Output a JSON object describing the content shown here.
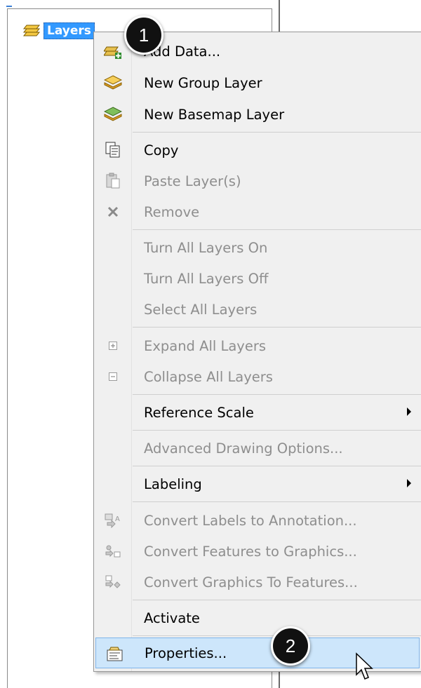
{
  "toc": {
    "root_label": "Layers"
  },
  "menu": {
    "items": [
      {
        "label": "Add Data...",
        "icon": "add-data-icon",
        "enabled": true,
        "submenu": false
      },
      {
        "label": "New Group Layer",
        "icon": "group-layer-icon",
        "enabled": true,
        "submenu": false
      },
      {
        "label": "New Basemap Layer",
        "icon": "basemap-layer-icon",
        "enabled": true,
        "submenu": false
      },
      {
        "label": "Copy",
        "icon": "copy-icon",
        "enabled": true,
        "submenu": false
      },
      {
        "label": "Paste Layer(s)",
        "icon": "paste-icon",
        "enabled": false,
        "submenu": false
      },
      {
        "label": "Remove",
        "icon": "remove-icon",
        "enabled": false,
        "submenu": false
      },
      {
        "label": "Turn All Layers On",
        "icon": "",
        "enabled": false,
        "submenu": false
      },
      {
        "label": "Turn All Layers Off",
        "icon": "",
        "enabled": false,
        "submenu": false
      },
      {
        "label": "Select All Layers",
        "icon": "",
        "enabled": false,
        "submenu": false
      },
      {
        "label": "Expand All Layers",
        "icon": "expand-icon",
        "enabled": false,
        "submenu": false
      },
      {
        "label": "Collapse All Layers",
        "icon": "collapse-icon",
        "enabled": false,
        "submenu": false
      },
      {
        "label": "Reference Scale",
        "icon": "",
        "enabled": true,
        "submenu": true
      },
      {
        "label": "Advanced Drawing Options...",
        "icon": "",
        "enabled": false,
        "submenu": false
      },
      {
        "label": "Labeling",
        "icon": "",
        "enabled": true,
        "submenu": true
      },
      {
        "label": "Convert Labels to Annotation...",
        "icon": "convert-labels-icon",
        "enabled": false,
        "submenu": false
      },
      {
        "label": "Convert Features to Graphics...",
        "icon": "convert-features-icon",
        "enabled": false,
        "submenu": false
      },
      {
        "label": "Convert Graphics To Features...",
        "icon": "convert-graphics-icon",
        "enabled": false,
        "submenu": false
      },
      {
        "label": "Activate",
        "icon": "",
        "enabled": true,
        "submenu": false
      },
      {
        "label": "Properties...",
        "icon": "properties-icon",
        "enabled": true,
        "submenu": false,
        "highlighted": true
      }
    ]
  },
  "callouts": {
    "first": "1",
    "second": "2"
  },
  "colors": {
    "selection": "#3399ff",
    "menu_bg": "#f0f0f0",
    "highlight_bg": "#cde6fb",
    "highlight_border": "#7eb4ea",
    "disabled_text": "#8e8e8e"
  }
}
